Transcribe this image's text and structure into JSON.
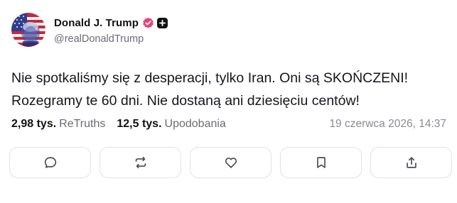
{
  "profile": {
    "display_name": "Donald J. Trump",
    "handle": "@realDonaldTrump",
    "avatar_icon": "avatar-flag-portrait",
    "verified_icon": "verified-badge-icon",
    "verified_color": "#e4447a",
    "plus_icon": "plus-badge-icon"
  },
  "post": {
    "line1": "Nie spotkaliśmy się z desperacji, tylko Iran. Oni są SKOŃCZENI!",
    "line2": "Rozegramy te 60 dni. Nie dostaną ani dziesięciu centów!"
  },
  "stats": {
    "retruths_count": "2,98 tys.",
    "retruths_label": "ReTruths",
    "likes_count": "12,5 tys.",
    "likes_label": "Upodobania",
    "timestamp": "19 czerwca 2026, 14:37"
  },
  "actions": [
    {
      "icon": "reply-icon"
    },
    {
      "icon": "retruth-icon"
    },
    {
      "icon": "like-icon"
    },
    {
      "icon": "bookmark-icon"
    },
    {
      "icon": "share-icon"
    }
  ],
  "colors": {
    "text": "#151520",
    "muted": "#6b6b78",
    "border": "#e2e2e8"
  }
}
